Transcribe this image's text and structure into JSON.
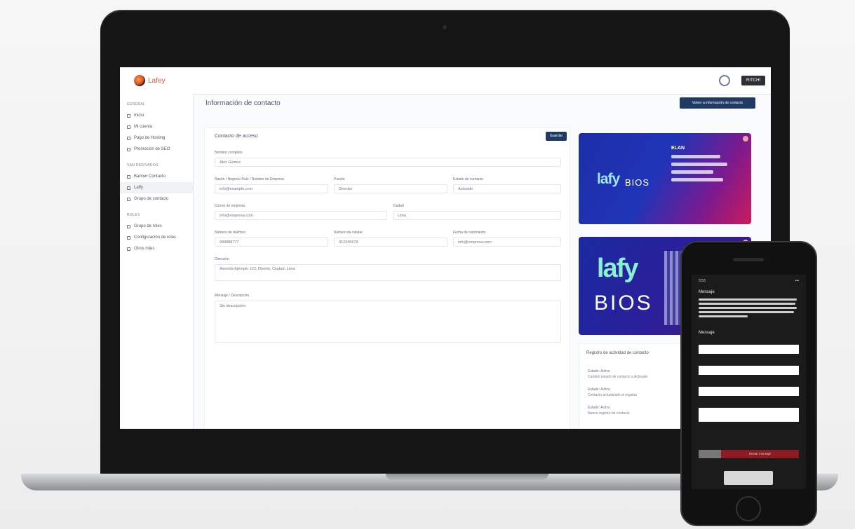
{
  "app": {
    "brand_name": "Lafey",
    "user_button": "RITCHI",
    "page_title": "Información de contacto",
    "primary_action": "Volver a información de contacto"
  },
  "sidebar": {
    "sections": [
      {
        "title": "GENERAL",
        "items": [
          "Inicio",
          "Mi cuenta",
          "Pago de Hosting",
          "Promoción de SEO"
        ]
      },
      {
        "title": "SAN DERIVADOS",
        "items": [
          "Banner Contacto",
          "Laffy",
          "Grupo de contacto"
        ]
      },
      {
        "title": "ROLES",
        "items": [
          "Grupo de roles",
          "Configuración de roles",
          "Otros roles"
        ]
      }
    ]
  },
  "form": {
    "title": "Contacto de acceso",
    "save_label": "Guardar",
    "fields": [
      {
        "label": "Nombre completo",
        "value": "Alex Gómez"
      },
      {
        "label": "Razón / Negocio Raíz / Nombre de Empresa",
        "value": "info@example.com"
      },
      {
        "label": "Puesto",
        "value": "Director"
      },
      {
        "label": "Estado de contacto",
        "value": "Activado"
      },
      {
        "label": "Correo de empresa",
        "value": "info@empresa.com"
      },
      {
        "label": "Ciudad",
        "value": "Lima"
      },
      {
        "label": "Número de teléfono",
        "value": "999888777"
      },
      {
        "label": "Número de celular",
        "value": "912345678"
      },
      {
        "label": "Fecha de nacimiento",
        "value": "info@empresa.com"
      },
      {
        "label": "Dirección",
        "value": "Avenida Ejemplo 123, Distrito, Ciudad, Lima"
      },
      {
        "label": "Mensaje / Descripción",
        "value": "Sin descripción"
      }
    ]
  },
  "previews": {
    "card_a": {
      "logo": "lafy",
      "logo_small": "BIOS",
      "name": "ELAN"
    },
    "card_b": {
      "logo_top": "lafy",
      "logo_bottom": "BIOS"
    }
  },
  "activity": {
    "title": "Registro de actividad de contacto",
    "items": [
      {
        "title": "Estado: Activo",
        "detail": "Cambió estado de contacto a Activado"
      },
      {
        "title": "Estado: Activo",
        "detail": "Contacto actualizado el registro"
      },
      {
        "title": "Estado: Activo",
        "detail": "Nuevo registro de contacto"
      }
    ]
  },
  "phone": {
    "time": "3:53",
    "battery": "•••",
    "section_label": "Mensaje",
    "form_title": "Mensaje",
    "send_label": "Enviar mensaje"
  },
  "colors": {
    "primary": "#1f3b64",
    "accent": "#d8452c",
    "danger": "#8c1b24"
  }
}
